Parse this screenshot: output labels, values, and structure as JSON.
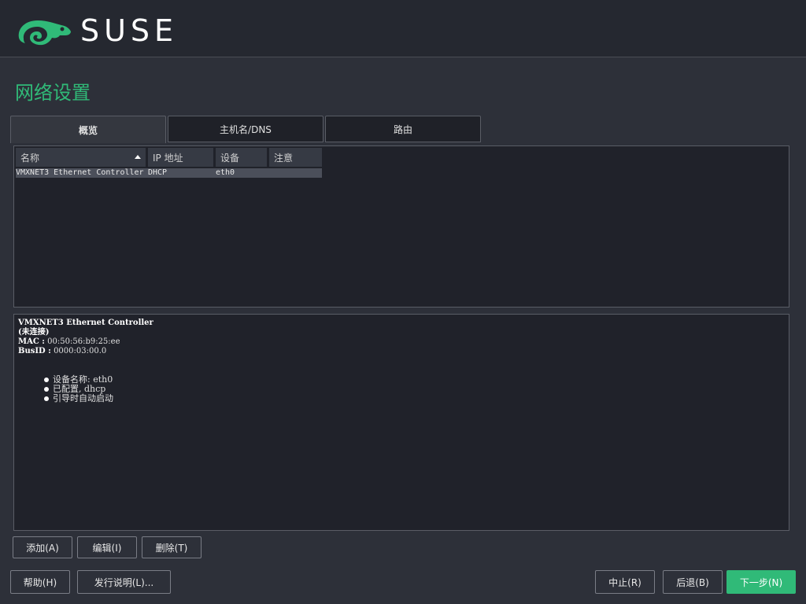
{
  "header": {
    "brand": "SUSE",
    "logo_icon": "chameleon-icon",
    "logo_color": "#30ba78"
  },
  "page": {
    "title": "网络设置"
  },
  "tabs": [
    {
      "label": "概览",
      "active": true
    },
    {
      "label": "主机名/DNS",
      "active": false
    },
    {
      "label": "路由",
      "active": false
    }
  ],
  "table": {
    "columns": [
      "名称",
      "IP 地址",
      "设备",
      "注意"
    ],
    "sort_column": "名称",
    "rows": [
      {
        "name": "VMXNET3 Ethernet Controller",
        "ip": "DHCP",
        "device": "eth0",
        "note": ""
      }
    ]
  },
  "details": {
    "title": "VMXNET3 Ethernet Controller",
    "status": "(未连接)",
    "mac_label": "MAC :",
    "mac_value": "00:50:56:b9:25:ee",
    "busid_label": "BusID :",
    "busid_value": "0000:03:00.0",
    "items": [
      "设备名称: eth0",
      "已配置, dhcp",
      "引导时自动启动"
    ]
  },
  "actions": {
    "add": "添加(A)",
    "edit": "编辑(I)",
    "delete": "删除(T)"
  },
  "footer": {
    "help": "帮助(H)",
    "release_notes": "发行说明(L)...",
    "abort": "中止(R)",
    "back": "后退(B)",
    "next": "下一步(N)"
  },
  "colors": {
    "accent": "#30ba78",
    "background": "#2d3039",
    "header_bg": "#252830",
    "panel_bg": "#20222a"
  }
}
